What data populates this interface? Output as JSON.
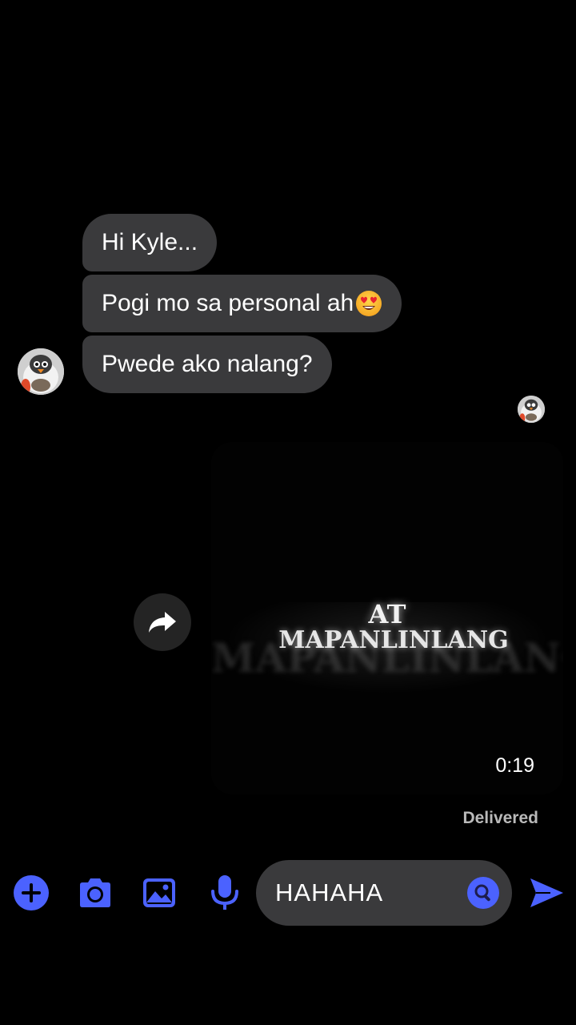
{
  "thread": {
    "messages": [
      {
        "text": "Hi Kyle...",
        "emoji": ""
      },
      {
        "text": "Pogi mo sa personal ah",
        "emoji": "heart-eyes-emoji"
      },
      {
        "text": "Pwede ako nalang?",
        "emoji": ""
      }
    ],
    "sender_avatar": "sender-avatar",
    "seen_avatar": "read-receipt-avatar",
    "video": {
      "line1": "AT",
      "line2": "MAPANLINLANG",
      "ghost_text": "MAPANLINLANG",
      "duration": "0:19"
    },
    "status": "Delivered"
  },
  "composer": {
    "input_value": "HAHAHA",
    "icons": [
      "plus-icon",
      "camera-icon",
      "gallery-icon",
      "microphone-icon",
      "emoji-icon",
      "send-icon"
    ],
    "accent_color": "#4b62ff"
  },
  "colors": {
    "background": "#000000",
    "bubble": "#3a3a3c",
    "text": "#ffffff",
    "muted": "#b9b9b9"
  }
}
